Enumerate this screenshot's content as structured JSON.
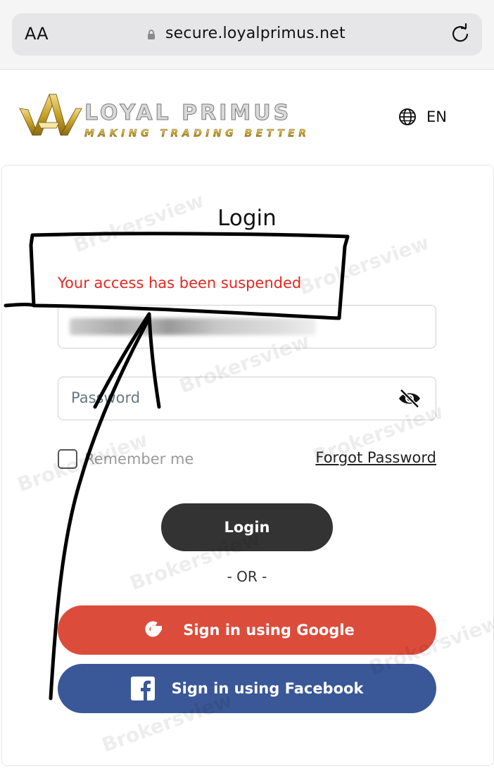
{
  "browser": {
    "text_size_label": "AA",
    "url": "secure.loyalprimus.net"
  },
  "header": {
    "brand_name": "LOYAL PRIMUS",
    "brand_tagline": "MAKING TRADING BETTER",
    "language": "EN"
  },
  "login": {
    "title": "Login",
    "error_message": "Your access has been suspended",
    "email_value": "",
    "password_placeholder": "Password",
    "remember_label": "Remember me",
    "forgot_label": "Forgot Password",
    "submit_label": "Login",
    "divider": "- OR -",
    "google_label": "Sign in using Google",
    "facebook_label": "Sign in using Facebook"
  },
  "watermark": "Brokersview",
  "colors": {
    "error": "#e5261f",
    "login_button": "#333333",
    "google": "#dc4c3b",
    "facebook": "#3a5897",
    "logo_gold": "#c9a227"
  }
}
